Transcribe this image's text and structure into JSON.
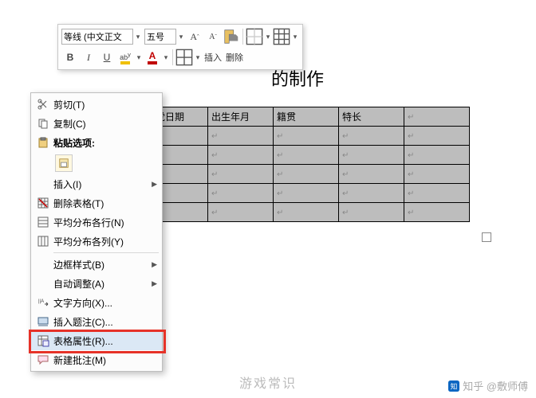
{
  "document": {
    "title_fragment": "的制作"
  },
  "mini_toolbar": {
    "font_name": "等线 (中文正文",
    "font_size": "五号",
    "grow": "A",
    "shrink": "A",
    "bold": "B",
    "italic": "I",
    "underline": "U",
    "highlight": "A",
    "fontcolor": "A",
    "insert_label": "插入",
    "delete_label": "删除"
  },
  "table": {
    "headers": [
      "入党日期",
      "出生年月",
      "籍贯",
      "特长"
    ],
    "rows": 6
  },
  "context_menu": {
    "items": [
      {
        "icon": "cut-icon",
        "label": "剪切(T)"
      },
      {
        "icon": "copy-icon",
        "label": "复制(C)"
      },
      {
        "icon": "paste-icon",
        "label": "粘贴选项:",
        "bold": true
      },
      {
        "icon": "",
        "label": "",
        "paste_opts": true
      },
      {
        "icon": "",
        "label": "插入(I)",
        "submenu": true
      },
      {
        "icon": "delete-table-icon",
        "label": "删除表格(T)"
      },
      {
        "icon": "distribute-rows-icon",
        "label": "平均分布各行(N)"
      },
      {
        "icon": "distribute-cols-icon",
        "label": "平均分布各列(Y)"
      },
      {
        "sep": true
      },
      {
        "icon": "",
        "label": "边框样式(B)",
        "submenu": true
      },
      {
        "icon": "",
        "label": "自动调整(A)",
        "submenu": true
      },
      {
        "icon": "text-direction-icon",
        "label": "文字方向(X)..."
      },
      {
        "icon": "caption-icon",
        "label": "插入题注(C)..."
      },
      {
        "icon": "props-icon",
        "label": "表格属性(R)...",
        "hl": true
      },
      {
        "icon": "comment-icon",
        "label": "新建批注(M)"
      }
    ]
  },
  "watermark": {
    "center": "游戏常识",
    "bottom_right": "知乎 @敷师傅"
  }
}
